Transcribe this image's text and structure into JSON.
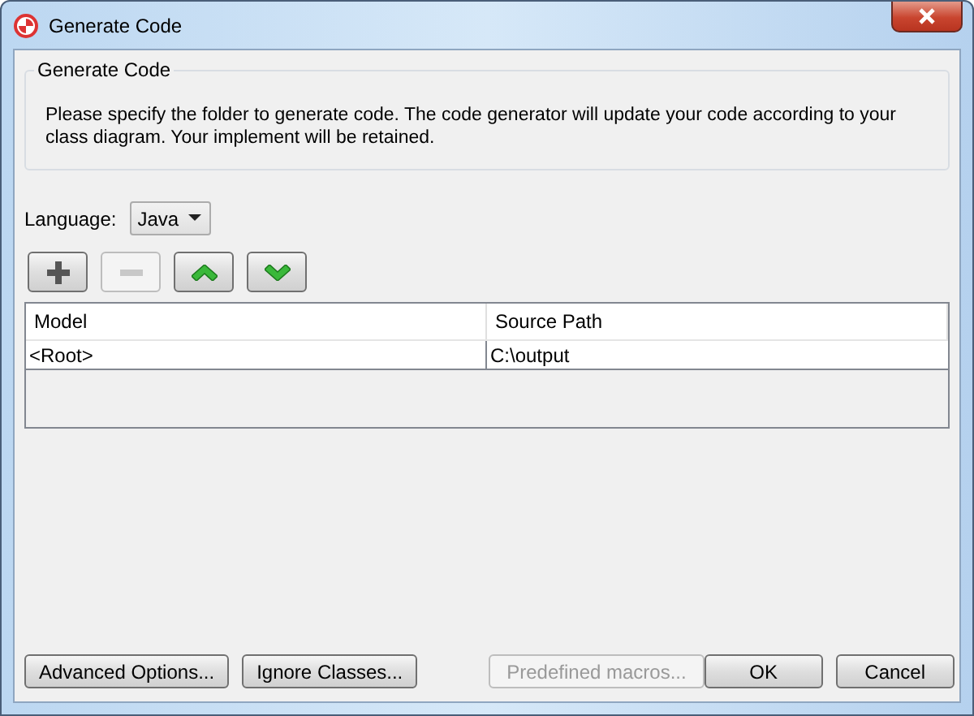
{
  "window": {
    "title": "Generate Code"
  },
  "group": {
    "title": "Generate Code",
    "description": "Please specify the folder to generate code. The code generator will update your code according to your class diagram. Your implement will be retained."
  },
  "language": {
    "label": "Language:",
    "value": "Java"
  },
  "toolbar": [
    {
      "kind": "add",
      "disabled": false
    },
    {
      "kind": "remove",
      "disabled": true
    },
    {
      "kind": "up",
      "disabled": false
    },
    {
      "kind": "down",
      "disabled": false
    }
  ],
  "table": {
    "columns": [
      "Model",
      "Source Path"
    ],
    "rows": [
      [
        "<Root>",
        "C:\\output"
      ]
    ]
  },
  "buttons_left": [
    {
      "label": "Advanced Options...",
      "disabled": false
    },
    {
      "label": "Ignore Classes...",
      "disabled": false
    },
    {
      "label": "Predefined macros...",
      "disabled": true
    }
  ],
  "buttons_right": [
    {
      "label": "OK",
      "disabled": false
    },
    {
      "label": "Cancel",
      "disabled": false
    }
  ]
}
